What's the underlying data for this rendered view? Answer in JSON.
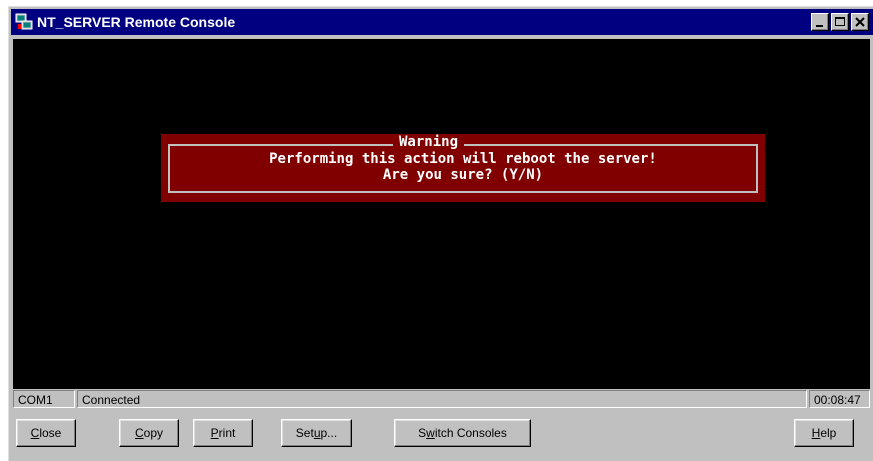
{
  "window": {
    "title": "NT_SERVER Remote Console",
    "accent_color": "#000080"
  },
  "console": {
    "background_color": "#000000",
    "dialog": {
      "title": "Warning",
      "line1": "Performing this action will reboot the server!",
      "line2": "Are you sure? (Y/N)",
      "background_color": "#800000"
    }
  },
  "status": {
    "port": "COM1",
    "state": "Connected",
    "time": "00:08:47"
  },
  "buttons": {
    "close": {
      "mnemonic": "C",
      "rest": "lose"
    },
    "copy": {
      "mnemonic": "C",
      "rest": "opy"
    },
    "print": {
      "mnemonic": "P",
      "rest": "rint"
    },
    "setup": {
      "before": "Set",
      "mnemonic": "u",
      "rest": "p..."
    },
    "switch": {
      "before": "S",
      "mnemonic": "w",
      "rest": "itch Consoles"
    },
    "help": {
      "mnemonic": "H",
      "rest": "elp"
    }
  },
  "icons": {
    "app": "console-app-icon",
    "minimize": "minimize-icon",
    "maximize": "maximize-icon",
    "close": "close-icon"
  }
}
